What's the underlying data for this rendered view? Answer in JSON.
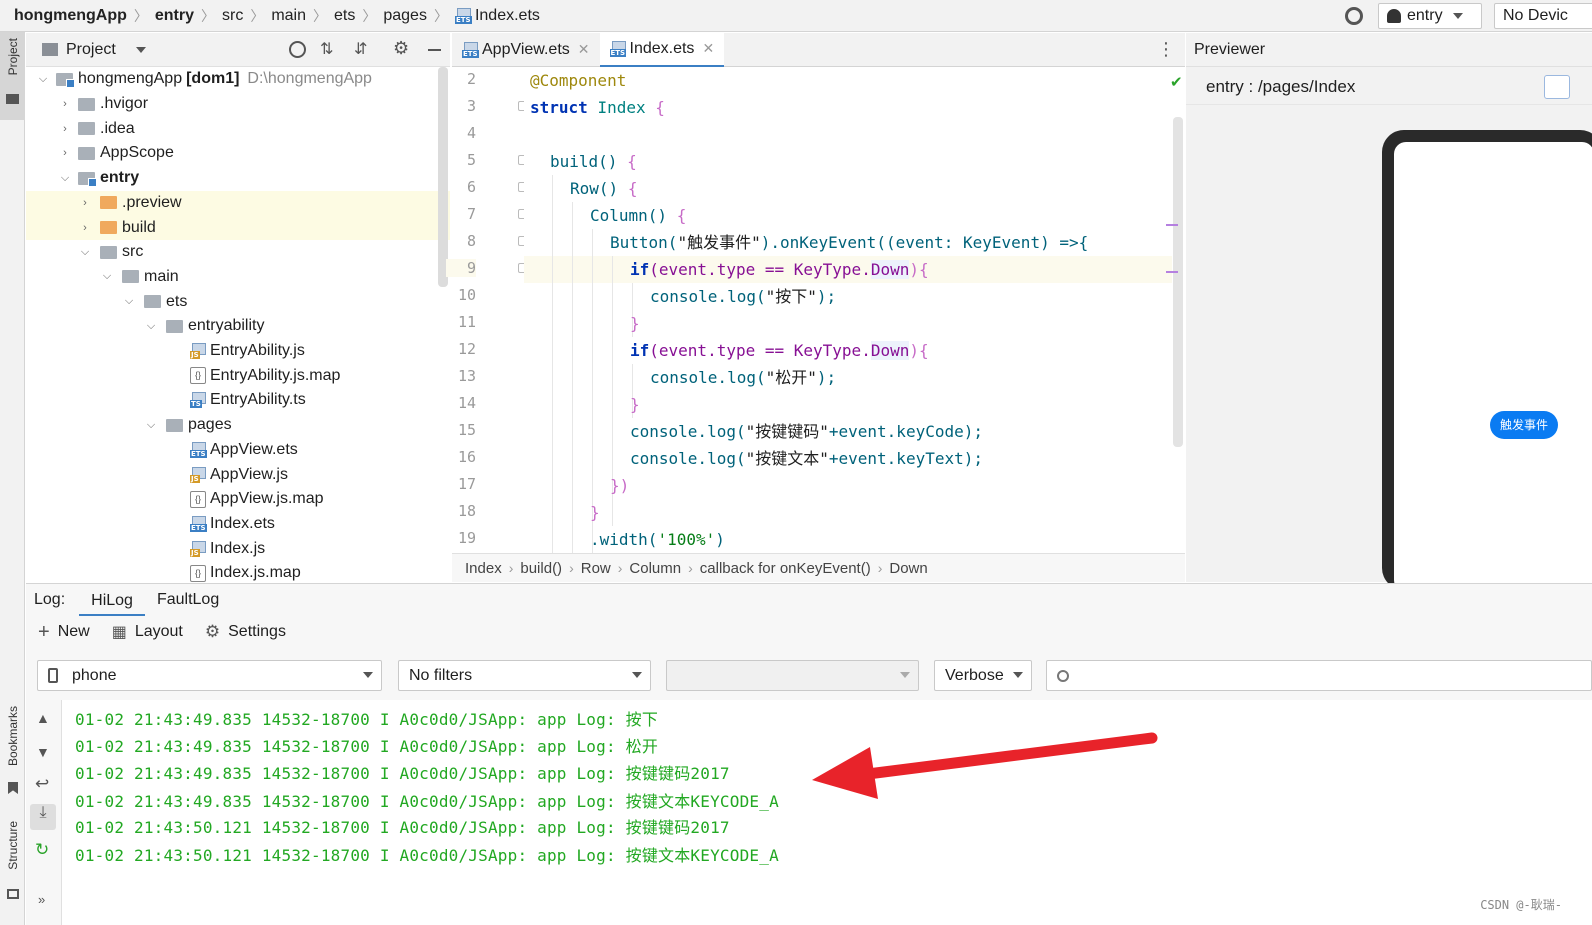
{
  "topbar": {
    "breadcrumbs": [
      "hongmengApp",
      "entry",
      "src",
      "main",
      "ets",
      "pages",
      "Index.ets"
    ],
    "run_config": "entry",
    "device": "No Devic"
  },
  "side": {
    "project": "Project",
    "bookmarks": "Bookmarks",
    "structure": "Structure"
  },
  "project": {
    "title": "Project",
    "tree": [
      {
        "label": "hongmengApp",
        "extra": "[dom1]",
        "path": "D:\\hongmengApp"
      },
      {
        "label": ".hvigor"
      },
      {
        "label": ".idea"
      },
      {
        "label": "AppScope"
      },
      {
        "label": "entry"
      },
      {
        "label": ".preview"
      },
      {
        "label": "build"
      },
      {
        "label": "src"
      },
      {
        "label": "main"
      },
      {
        "label": "ets"
      },
      {
        "label": "entryability"
      },
      {
        "label": "EntryAbility.js"
      },
      {
        "label": "EntryAbility.js.map"
      },
      {
        "label": "EntryAbility.ts"
      },
      {
        "label": "pages"
      },
      {
        "label": "AppView.ets"
      },
      {
        "label": "AppView.js"
      },
      {
        "label": "AppView.js.map"
      },
      {
        "label": "Index.ets"
      },
      {
        "label": "Index.js"
      },
      {
        "label": "Index.js.map"
      }
    ]
  },
  "editor": {
    "tabs": [
      {
        "label": "AppView.ets"
      },
      {
        "label": "Index.ets"
      }
    ],
    "line_numbers": [
      "2",
      "3",
      "4",
      "5",
      "6",
      "7",
      "8",
      "9",
      "10",
      "11",
      "12",
      "13",
      "14",
      "15",
      "16",
      "17",
      "18",
      "19"
    ],
    "code": {
      "l2_anno": "@Component",
      "l3_kw": "struct",
      "l3_name": "Index",
      "l5_fn": "build()",
      "l6_fn": "Row()",
      "l7_fn": "Column()",
      "l8_a": "Button(",
      "l8_str": "\"触发事件\"",
      "l8_b": ").onKeyEvent((event: KeyEvent) =>{",
      "l9_kw": "if",
      "l9_a": "(event.type == KeyType.",
      "l9_enum": "Down",
      "l9_b": "){",
      "l10_a": "console.log(",
      "l10_str": "\"按下\"",
      "l10_b": ");",
      "l11": "}",
      "l12_kw": "if",
      "l12_a": "(event.type == KeyType.",
      "l12_enum": "Down",
      "l12_b": "){",
      "l13_a": "console.log(",
      "l13_str": "\"松开\"",
      "l13_b": ");",
      "l14": "}",
      "l15_a": "console.log(",
      "l15_str": "\"按键键码\"",
      "l15_b": "+event.keyCode);",
      "l16_a": "console.log(",
      "l16_str": "\"按键文本\"",
      "l16_b": "+event.keyText);",
      "l17": "})",
      "l18": "}",
      "l19_a": ".width(",
      "l19_str": "'100%'",
      "l19_b": ")"
    },
    "breadcrumb": [
      "Index",
      "build()",
      "Row",
      "Column",
      "callback for onKeyEvent()",
      "Down"
    ]
  },
  "previewer": {
    "title": "Previewer",
    "path": "entry : /pages/Index",
    "button": "触发事件"
  },
  "log": {
    "label": "Log:",
    "tabs": [
      "HiLog",
      "FaultLog"
    ],
    "toolbar": {
      "new": "New",
      "layout": "Layout",
      "settings": "Settings"
    },
    "device": "phone",
    "filter": "No filters",
    "level": "Verbose",
    "lines": [
      "01-02 21:43:49.835 14532-18700 I A0c0d0/JSApp: app Log: 按下",
      "01-02 21:43:49.835 14532-18700 I A0c0d0/JSApp: app Log: 松开",
      "01-02 21:43:49.835 14532-18700 I A0c0d0/JSApp: app Log: 按键键码2017",
      "01-02 21:43:49.835 14532-18700 I A0c0d0/JSApp: app Log: 按键文本KEYCODE_A",
      "01-02 21:43:50.121 14532-18700 I A0c0d0/JSApp: app Log: 按键键码2017",
      "01-02 21:43:50.121 14532-18700 I A0c0d0/JSApp: app Log: 按键文本KEYCODE_A"
    ]
  },
  "watermark": "CSDN @-耿瑞-",
  "colors": {
    "accent": "#3b7fc4",
    "log_text": "#22a822",
    "arrow": "#e8232a",
    "preview_button": "#0a7bf2"
  }
}
